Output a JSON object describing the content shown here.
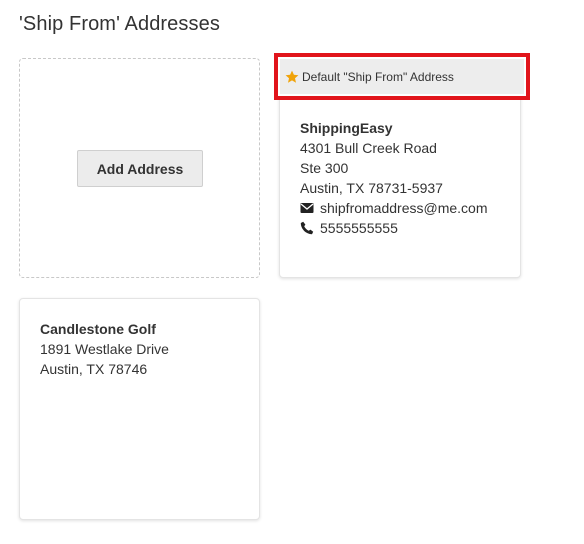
{
  "page": {
    "title": "'Ship From' Addresses"
  },
  "add_card": {
    "button_label": "Add Address"
  },
  "default_address": {
    "banner_label": "Default \"Ship From\" Address",
    "banner_icon": "star-icon",
    "banner_icon_color": "#f0a30a",
    "highlight_color": "#e1141b",
    "name": "ShippingEasy",
    "street": "4301 Bull Creek Road",
    "suite": "Ste 300",
    "city_state_zip": "Austin, TX 78731-5937",
    "email_icon": "envelope-icon",
    "email": "shipfromaddress@me.com",
    "phone_icon": "phone-icon",
    "phone": "5555555555"
  },
  "addresses": [
    {
      "name": "Candlestone Golf",
      "street": "1891 Westlake Drive",
      "city_state_zip": "Austin, TX 78746"
    }
  ]
}
